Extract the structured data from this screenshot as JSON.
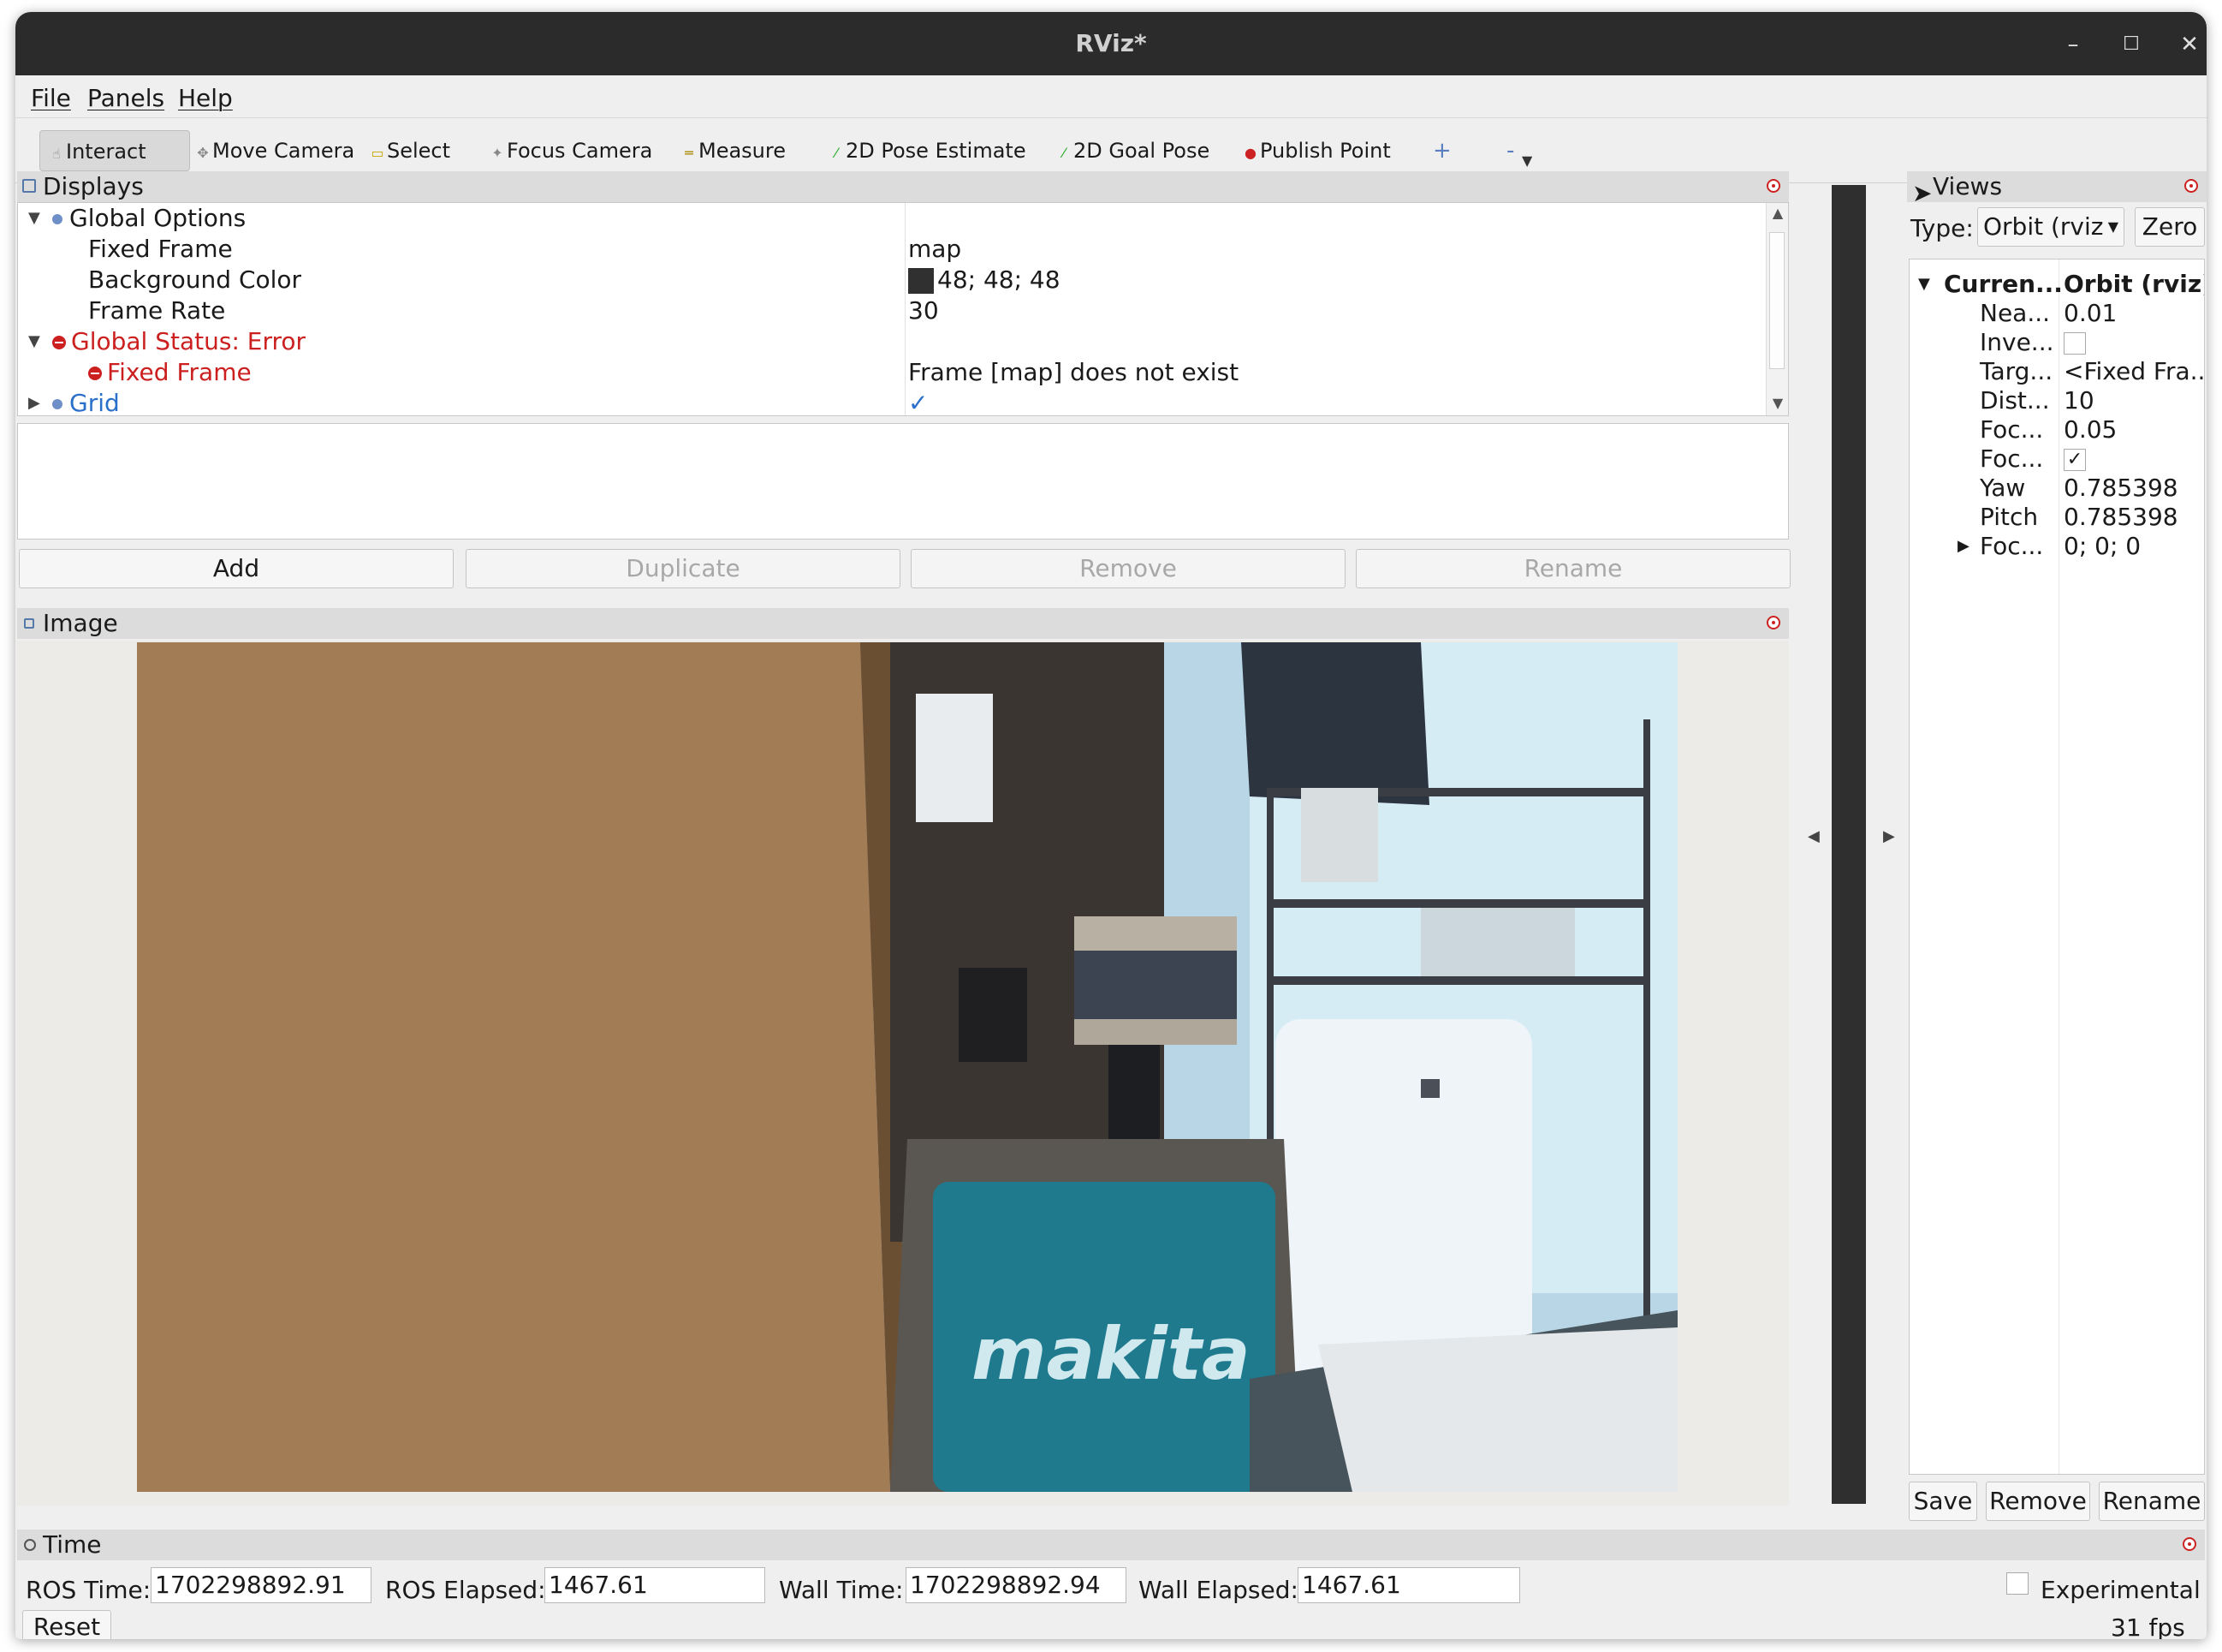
{
  "window": {
    "title": "RViz*"
  },
  "menu": {
    "file": "File",
    "panels": "Panels",
    "help": "Help"
  },
  "toolbar": {
    "interact": "Interact",
    "move_camera": "Move Camera",
    "select": "Select",
    "focus_camera": "Focus Camera",
    "measure": "Measure",
    "pose_estimate": "2D Pose Estimate",
    "goal_pose": "2D Goal Pose",
    "publish_point": "Publish Point",
    "add_tool": "+",
    "remove_tool": "-"
  },
  "displays": {
    "title": "Displays",
    "global_options": "Global Options",
    "fixed_frame_label": "Fixed Frame",
    "fixed_frame_value": "map",
    "background_color_label": "Background Color",
    "background_color_value": "48; 48; 48",
    "background_color_hex": "#303030",
    "frame_rate_label": "Frame Rate",
    "frame_rate_value": "30",
    "global_status": "Global Status: Error",
    "status_fixed_frame_label": "Fixed Frame",
    "status_fixed_frame_value": "Frame [map] does not exist",
    "grid_label": "Grid",
    "buttons": {
      "add": "Add",
      "duplicate": "Duplicate",
      "remove": "Remove",
      "rename": "Rename"
    }
  },
  "image_panel": {
    "title": "Image"
  },
  "views": {
    "title": "Views",
    "type_label": "Type:",
    "type_value": "Orbit (rviz",
    "zero": "Zero",
    "current_label": "Curren...",
    "current_value": "Orbit (rviz)",
    "rows": [
      {
        "name": "Nea...",
        "value": "0.01"
      },
      {
        "name": "Inve...",
        "value": ""
      },
      {
        "name": "Targ...",
        "value": "<Fixed Fra..."
      },
      {
        "name": "Dist...",
        "value": "10"
      },
      {
        "name": "Foc...",
        "value": "0.05"
      },
      {
        "name": "Foc...",
        "value": "✓"
      },
      {
        "name": "Yaw",
        "value": "0.785398"
      },
      {
        "name": "Pitch",
        "value": "0.785398"
      },
      {
        "name": "Foc...",
        "value": "0; 0; 0"
      }
    ],
    "buttons": {
      "save": "Save",
      "remove": "Remove",
      "rename": "Rename"
    }
  },
  "time": {
    "title": "Time",
    "ros_time_label": "ROS Time:",
    "ros_time": "1702298892.91",
    "ros_elapsed_label": "ROS Elapsed:",
    "ros_elapsed": "1467.61",
    "wall_time_label": "Wall Time:",
    "wall_time": "1702298892.94",
    "wall_elapsed_label": "Wall Elapsed:",
    "wall_elapsed": "1467.61",
    "experimental": "Experimental",
    "reset": "Reset",
    "fps": "31 fps"
  },
  "colors": {
    "error": "#cc1f1f",
    "titlebar": "#2b2b2b",
    "panel_header": "#dcdcdc"
  }
}
